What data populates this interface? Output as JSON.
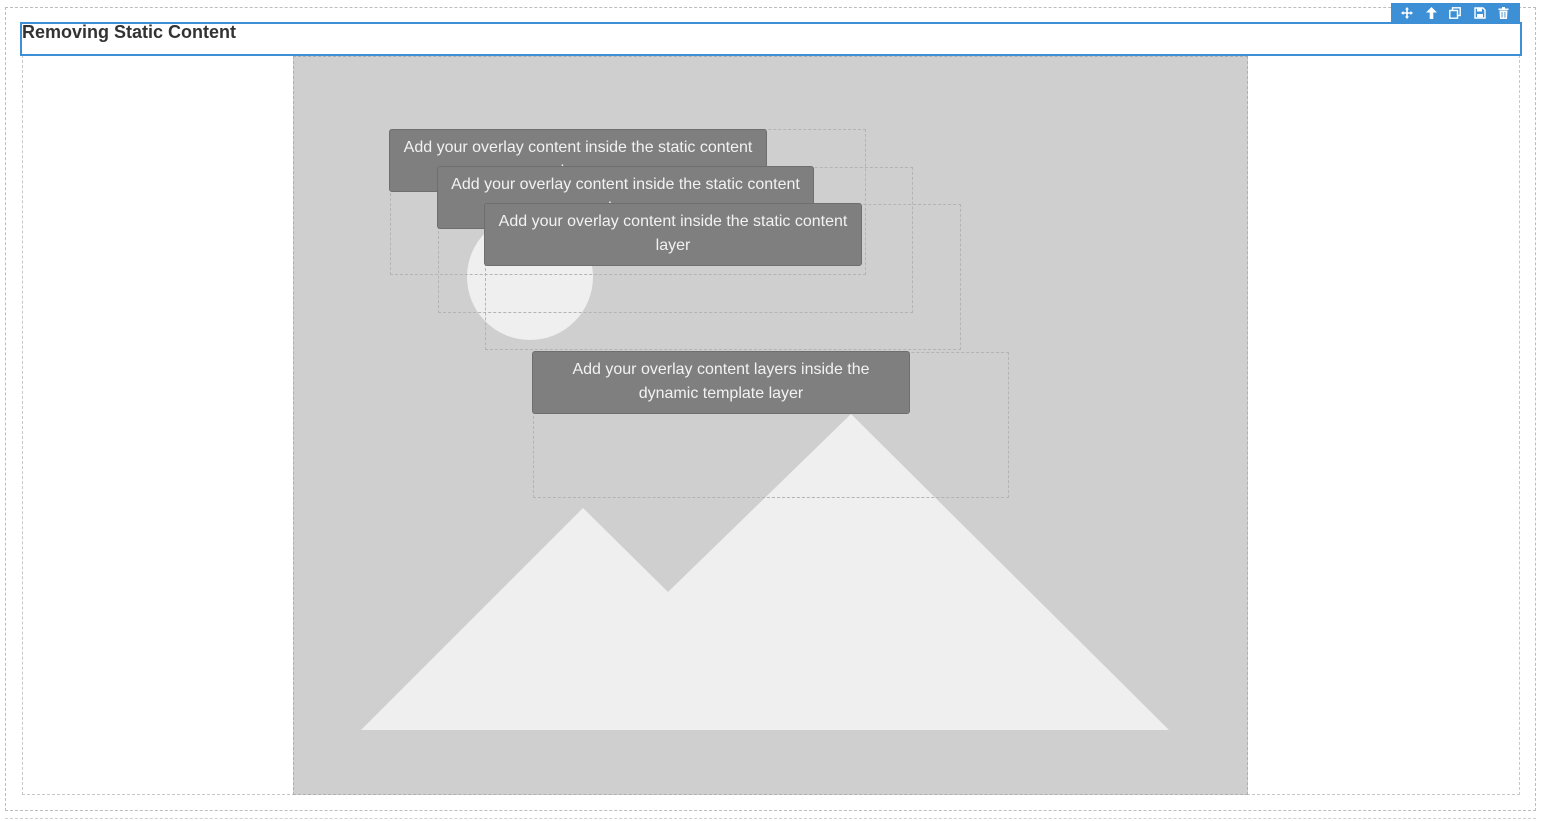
{
  "title": "Removing Static Content",
  "toolbar": {
    "buttons": [
      {
        "name": "move-icon",
        "label": "Move"
      },
      {
        "name": "arrow-up-icon",
        "label": "Select parent"
      },
      {
        "name": "copy-icon",
        "label": "Clone"
      },
      {
        "name": "save-icon",
        "label": "Save"
      },
      {
        "name": "trash-icon",
        "label": "Delete"
      }
    ]
  },
  "colors": {
    "accent": "#3d8fd6",
    "placeholder_bg": "#cfcfcf",
    "placeholder_shape": "#efefef",
    "overlay_bg": "#7f7f7f"
  },
  "overlays": {
    "static_1": "Add your overlay content inside the static content layer",
    "static_2": "Add your overlay content inside the static content layer",
    "static_3": "Add your overlay content inside the static content layer",
    "dynamic": "Add your overlay content layers inside the dynamic template layer"
  }
}
